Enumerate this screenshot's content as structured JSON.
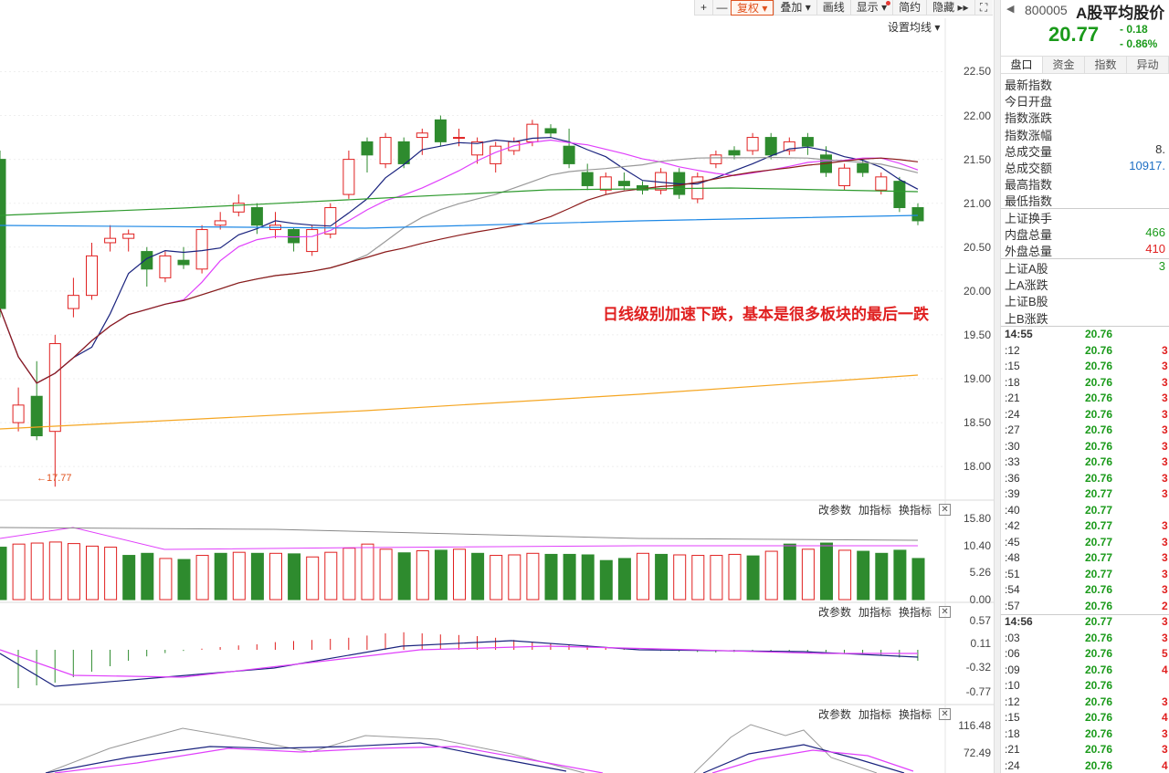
{
  "toolbar": {
    "plus": "+",
    "minus": "—",
    "fuquan": "复权",
    "diejia": "叠加",
    "huaxian": "画线",
    "xianshi": "显示",
    "jianyue": "简约",
    "yincang": "隐藏",
    "fullscreen": "⛶"
  },
  "set_ma_label": "设置均线 ▾",
  "annotation": "日线级别加速下跌，基本是很多板块的最后一跌",
  "low_label": "←17.77",
  "main_axis": [
    "22.50",
    "22.00",
    "21.50",
    "21.00",
    "20.50",
    "20.00",
    "19.50",
    "19.00",
    "18.50",
    "18.00"
  ],
  "vol_axis": [
    "15.80",
    "10.40",
    "5.26",
    "0.00"
  ],
  "macd_axis": [
    "0.57",
    "0.11",
    "-0.32",
    "-0.77"
  ],
  "kdj_axis": [
    "116.48",
    "72.49"
  ],
  "sub_controls": {
    "change": "改参数",
    "add": "加指标",
    "swap": "换指标",
    "close": "✕"
  },
  "right": {
    "arrow": "◀",
    "code": "800005",
    "name": "A股平均股价",
    "price": "20.77",
    "change": "- 0.18",
    "change_pct": "- 0.86%",
    "tabs": [
      "盘口",
      "资金",
      "指数",
      "异动"
    ],
    "stats": [
      {
        "k": "最新指数",
        "v": ""
      },
      {
        "k": "今日开盘",
        "v": ""
      },
      {
        "k": "指数涨跌",
        "v": ""
      },
      {
        "k": "指数涨幅",
        "v": ""
      },
      {
        "k": "总成交量",
        "v": "8."
      },
      {
        "k": "总成交额",
        "v": "10917."
      },
      {
        "k": "最高指数",
        "v": ""
      },
      {
        "k": "最低指数",
        "v": ""
      }
    ],
    "stats2": [
      {
        "k": "上证换手",
        "v": ""
      },
      {
        "k": "内盘总量",
        "v": "466"
      },
      {
        "k": "外盘总量",
        "v": "410"
      }
    ],
    "stats3": [
      {
        "k": "上证A股",
        "v": "3"
      },
      {
        "k": "上A涨跌",
        "v": ""
      },
      {
        "k": "上证B股",
        "v": ""
      },
      {
        "k": "上B涨跌",
        "v": ""
      }
    ],
    "ticks": [
      {
        "t": "14:55",
        "p": "20.76",
        "v": "",
        "g": false
      },
      {
        "t": ":12",
        "p": "20.76",
        "v": "3",
        "g": false
      },
      {
        "t": ":15",
        "p": "20.76",
        "v": "3",
        "g": false
      },
      {
        "t": ":18",
        "p": "20.76",
        "v": "3",
        "g": false
      },
      {
        "t": ":21",
        "p": "20.76",
        "v": "3",
        "g": false
      },
      {
        "t": ":24",
        "p": "20.76",
        "v": "3",
        "g": false
      },
      {
        "t": ":27",
        "p": "20.76",
        "v": "3",
        "g": false
      },
      {
        "t": ":30",
        "p": "20.76",
        "v": "3",
        "g": false
      },
      {
        "t": ":33",
        "p": "20.76",
        "v": "3",
        "g": false
      },
      {
        "t": ":36",
        "p": "20.76",
        "v": "3",
        "g": false
      },
      {
        "t": ":39",
        "p": "20.77",
        "v": "3",
        "g": false
      },
      {
        "t": ":40",
        "p": "20.77",
        "v": "",
        "g": false
      },
      {
        "t": ":42",
        "p": "20.77",
        "v": "3",
        "g": false
      },
      {
        "t": ":45",
        "p": "20.77",
        "v": "3",
        "g": false
      },
      {
        "t": ":48",
        "p": "20.77",
        "v": "3",
        "g": false
      },
      {
        "t": ":51",
        "p": "20.77",
        "v": "3",
        "g": false
      },
      {
        "t": ":54",
        "p": "20.76",
        "v": "3",
        "g": false
      },
      {
        "t": ":57",
        "p": "20.76",
        "v": "2",
        "g": false
      },
      {
        "t": "14:56",
        "p": "20.77",
        "v": "3",
        "g": false
      },
      {
        "t": ":03",
        "p": "20.76",
        "v": "3",
        "g": false
      },
      {
        "t": ":06",
        "p": "20.76",
        "v": "5",
        "g": false
      },
      {
        "t": ":09",
        "p": "20.76",
        "v": "4",
        "g": false
      },
      {
        "t": ":10",
        "p": "20.76",
        "v": "",
        "g": false
      },
      {
        "t": ":12",
        "p": "20.76",
        "v": "3",
        "g": false
      },
      {
        "t": ":15",
        "p": "20.76",
        "v": "4",
        "g": false
      },
      {
        "t": ":18",
        "p": "20.76",
        "v": "3",
        "g": false
      },
      {
        "t": ":21",
        "p": "20.76",
        "v": "3",
        "g": false
      },
      {
        "t": ":24",
        "p": "20.76",
        "v": "4",
        "g": false
      }
    ]
  },
  "colors": {
    "up": "#e02020",
    "down": "#2e8b2e",
    "ma5": "#1a237e",
    "ma10": "#e040fb",
    "ma20": "#999999",
    "ma30": "#8b1a1a",
    "ma60": "#2e9a2e",
    "ma120": "#1e88e5",
    "ma250": "#f5a623"
  },
  "chart_data": {
    "type": "candlestick",
    "ylim": [
      17.7,
      22.9
    ],
    "candles": [
      [
        21.5,
        19.8,
        21.6,
        19.7
      ],
      [
        18.5,
        18.7,
        18.9,
        18.4
      ],
      [
        18.8,
        18.35,
        19.2,
        18.3
      ],
      [
        18.4,
        19.4,
        19.5,
        17.77
      ],
      [
        19.8,
        19.95,
        20.15,
        19.7
      ],
      [
        19.95,
        20.4,
        20.55,
        19.9
      ],
      [
        20.55,
        20.6,
        20.75,
        20.45
      ],
      [
        20.6,
        20.65,
        20.7,
        20.45
      ],
      [
        20.45,
        20.25,
        20.5,
        20.05
      ],
      [
        20.15,
        20.4,
        20.45,
        20.1
      ],
      [
        20.35,
        20.3,
        20.5,
        20.25
      ],
      [
        20.25,
        20.7,
        20.75,
        20.2
      ],
      [
        20.75,
        20.8,
        20.9,
        20.7
      ],
      [
        20.9,
        21.0,
        21.1,
        20.85
      ],
      [
        20.95,
        20.75,
        21.0,
        20.65
      ],
      [
        20.7,
        20.75,
        20.9,
        20.6
      ],
      [
        20.7,
        20.55,
        20.72,
        20.45
      ],
      [
        20.45,
        20.7,
        20.75,
        20.4
      ],
      [
        20.65,
        20.95,
        21.0,
        20.6
      ],
      [
        21.1,
        21.5,
        21.6,
        21.05
      ],
      [
        21.7,
        21.55,
        21.75,
        21.35
      ],
      [
        21.45,
        21.75,
        21.8,
        21.4
      ],
      [
        21.7,
        21.45,
        21.75,
        21.4
      ],
      [
        21.75,
        21.8,
        21.85,
        21.55
      ],
      [
        21.95,
        21.7,
        22.0,
        21.65
      ],
      [
        21.75,
        21.75,
        21.85,
        21.65
      ],
      [
        21.55,
        21.7,
        21.75,
        21.45
      ],
      [
        21.45,
        21.65,
        21.7,
        21.35
      ],
      [
        21.6,
        21.7,
        21.75,
        21.55
      ],
      [
        21.7,
        21.9,
        21.95,
        21.65
      ],
      [
        21.85,
        21.8,
        21.9,
        21.75
      ],
      [
        21.65,
        21.45,
        21.85,
        21.4
      ],
      [
        21.35,
        21.2,
        21.45,
        21.15
      ],
      [
        21.15,
        21.3,
        21.35,
        21.1
      ],
      [
        21.25,
        21.2,
        21.35,
        21.15
      ],
      [
        21.2,
        21.15,
        21.25,
        21.1
      ],
      [
        21.15,
        21.35,
        21.4,
        21.1
      ],
      [
        21.35,
        21.1,
        21.4,
        21.05
      ],
      [
        21.05,
        21.3,
        21.35,
        21.0
      ],
      [
        21.45,
        21.55,
        21.6,
        21.4
      ],
      [
        21.6,
        21.55,
        21.65,
        21.5
      ],
      [
        21.6,
        21.75,
        21.8,
        21.55
      ],
      [
        21.75,
        21.55,
        21.8,
        21.5
      ],
      [
        21.6,
        21.7,
        21.75,
        21.55
      ],
      [
        21.75,
        21.65,
        21.8,
        21.55
      ],
      [
        21.55,
        21.35,
        21.65,
        21.3
      ],
      [
        21.2,
        21.4,
        21.45,
        21.15
      ],
      [
        21.45,
        21.35,
        21.5,
        21.3
      ],
      [
        21.15,
        21.3,
        21.35,
        21.1
      ],
      [
        21.25,
        20.95,
        21.3,
        20.9
      ],
      [
        20.95,
        20.8,
        21.0,
        20.75
      ]
    ],
    "volume": [
      [
        10.2,
        true
      ],
      [
        10.8,
        false
      ],
      [
        11.0,
        false
      ],
      [
        11.2,
        false
      ],
      [
        10.9,
        false
      ],
      [
        10.4,
        false
      ],
      [
        10.2,
        false
      ],
      [
        8.6,
        true
      ],
      [
        9.0,
        true
      ],
      [
        8.0,
        false
      ],
      [
        7.8,
        true
      ],
      [
        8.6,
        false
      ],
      [
        9.0,
        true
      ],
      [
        9.2,
        false
      ],
      [
        9.0,
        true
      ],
      [
        9.0,
        false
      ],
      [
        8.9,
        true
      ],
      [
        8.3,
        false
      ],
      [
        9.2,
        false
      ],
      [
        10.0,
        false
      ],
      [
        10.8,
        false
      ],
      [
        9.8,
        false
      ],
      [
        9.1,
        true
      ],
      [
        9.5,
        false
      ],
      [
        9.6,
        true
      ],
      [
        9.8,
        false
      ],
      [
        9.0,
        true
      ],
      [
        8.6,
        false
      ],
      [
        8.7,
        false
      ],
      [
        9.0,
        false
      ],
      [
        8.8,
        true
      ],
      [
        8.8,
        true
      ],
      [
        8.7,
        true
      ],
      [
        7.6,
        true
      ],
      [
        8.0,
        true
      ],
      [
        9.0,
        false
      ],
      [
        8.8,
        true
      ],
      [
        8.7,
        false
      ],
      [
        8.6,
        false
      ],
      [
        8.6,
        false
      ],
      [
        8.8,
        false
      ],
      [
        8.5,
        true
      ],
      [
        9.4,
        false
      ],
      [
        10.8,
        true
      ],
      [
        9.8,
        false
      ],
      [
        11.0,
        true
      ],
      [
        9.6,
        false
      ],
      [
        9.4,
        true
      ],
      [
        9.0,
        true
      ],
      [
        9.6,
        true
      ],
      [
        8.0,
        true
      ]
    ],
    "macd": [
      -0.7,
      -0.65,
      -0.6,
      -0.5,
      -0.4,
      -0.3,
      -0.2,
      -0.12,
      -0.06,
      -0.02,
      0.02,
      0.05,
      0.08,
      0.1,
      0.14,
      0.16,
      0.18,
      0.2,
      0.22,
      0.26,
      0.3,
      0.32,
      0.3,
      0.28,
      0.27,
      0.25,
      0.22,
      0.18,
      0.14,
      0.12,
      0.1,
      0.08,
      0.05,
      0.02,
      0.0,
      -0.02,
      -0.03,
      -0.04,
      -0.05,
      -0.04,
      -0.03,
      -0.02,
      -0.02,
      -0.03,
      -0.04,
      -0.06,
      -0.08,
      -0.1,
      -0.14,
      -0.2
    ],
    "title": "",
    "xlabel": "",
    "ylabel": ""
  }
}
